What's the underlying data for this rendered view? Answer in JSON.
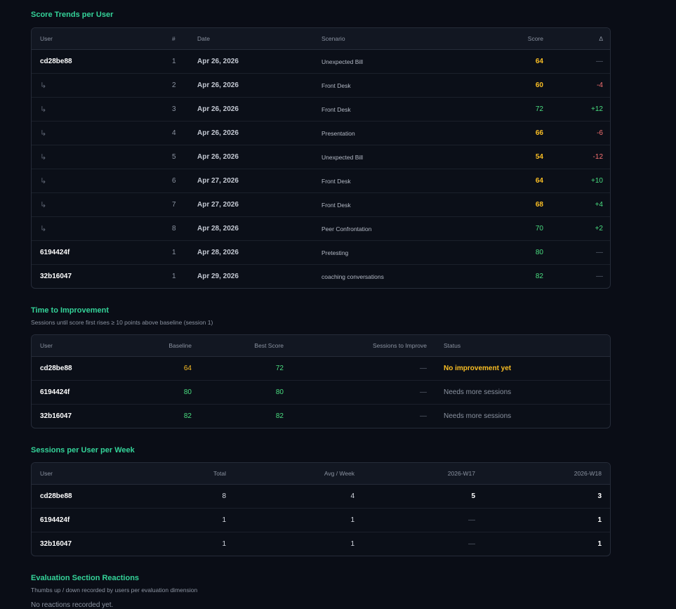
{
  "score_trends": {
    "title": "Score Trends per User",
    "headers": {
      "user": "User",
      "num": "#",
      "date": "Date",
      "scenario": "Scenario",
      "score": "Score",
      "delta": "Δ"
    },
    "rows": [
      {
        "user": "cd28be88",
        "num": "1",
        "date": "Apr 26, 2026",
        "scenario": "Unexpected Bill",
        "score": "64",
        "delta": "—"
      },
      {
        "user": "↳",
        "num": "2",
        "date": "Apr 26, 2026",
        "scenario": "Front Desk",
        "score": "60",
        "delta": "-4"
      },
      {
        "user": "↳",
        "num": "3",
        "date": "Apr 26, 2026",
        "scenario": "Front Desk",
        "score": "72",
        "delta": "+12"
      },
      {
        "user": "↳",
        "num": "4",
        "date": "Apr 26, 2026",
        "scenario": "Presentation",
        "score": "66",
        "delta": "-6"
      },
      {
        "user": "↳",
        "num": "5",
        "date": "Apr 26, 2026",
        "scenario": "Unexpected Bill",
        "score": "54",
        "delta": "-12"
      },
      {
        "user": "↳",
        "num": "6",
        "date": "Apr 27, 2026",
        "scenario": "Front Desk",
        "score": "64",
        "delta": "+10"
      },
      {
        "user": "↳",
        "num": "7",
        "date": "Apr 27, 2026",
        "scenario": "Front Desk",
        "score": "68",
        "delta": "+4"
      },
      {
        "user": "↳",
        "num": "8",
        "date": "Apr 28, 2026",
        "scenario": "Peer Confrontation",
        "score": "70",
        "delta": "+2"
      },
      {
        "user": "6194424f",
        "num": "1",
        "date": "Apr 28, 2026",
        "scenario": "Pretesting",
        "score": "80",
        "delta": "—"
      },
      {
        "user": "32b16047",
        "num": "1",
        "date": "Apr 29, 2026",
        "scenario": "coaching conversations",
        "score": "82",
        "delta": "—"
      }
    ]
  },
  "time_to_improvement": {
    "title": "Time to Improvement",
    "subtitle": "Sessions until score first rises ≥ 10 points above baseline (session 1)",
    "headers": {
      "user": "User",
      "baseline": "Baseline",
      "best": "Best Score",
      "sessions": "Sessions to Improve",
      "status": "Status"
    },
    "rows": [
      {
        "user": "cd28be88",
        "baseline": "64",
        "best": "72",
        "sessions": "—",
        "status": "No improvement yet"
      },
      {
        "user": "6194424f",
        "baseline": "80",
        "best": "80",
        "sessions": "—",
        "status": "Needs more sessions"
      },
      {
        "user": "32b16047",
        "baseline": "82",
        "best": "82",
        "sessions": "—",
        "status": "Needs more sessions"
      }
    ]
  },
  "sessions_per_week": {
    "title": "Sessions per User per Week",
    "headers": {
      "user": "User",
      "total": "Total",
      "avg": "Avg / Week",
      "w17": "2026-W17",
      "w18": "2026-W18"
    },
    "rows": [
      {
        "user": "cd28be88",
        "total": "8",
        "avg": "4",
        "w17": "5",
        "w18": "3"
      },
      {
        "user": "6194424f",
        "total": "1",
        "avg": "1",
        "w17": "—",
        "w18": "1"
      },
      {
        "user": "32b16047",
        "total": "1",
        "avg": "1",
        "w17": "—",
        "w18": "1"
      }
    ]
  },
  "reactions": {
    "title": "Evaluation Section Reactions",
    "subtitle": "Thumbs up / down recorded by users per evaluation dimension",
    "empty": "No reactions recorded yet."
  },
  "colors": {
    "background": "#0a0d16",
    "accent_title": "#34d399",
    "score_mid": "#fbbf24",
    "score_high": "#4ade80",
    "delta_negative": "#f87171"
  }
}
